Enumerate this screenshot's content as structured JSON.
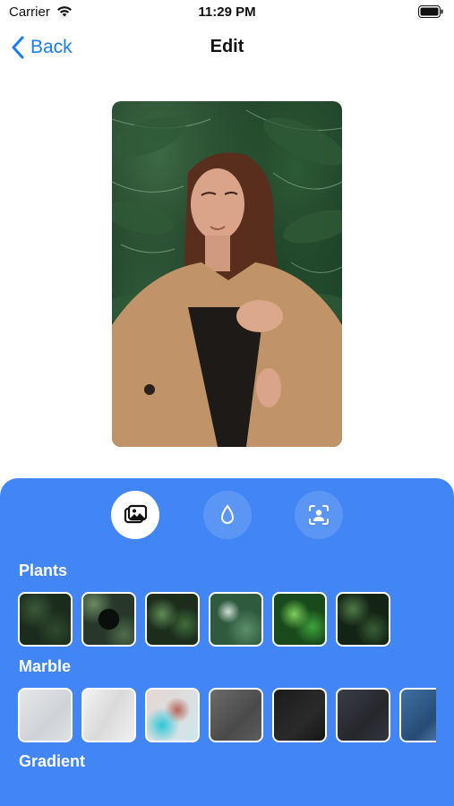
{
  "status_bar": {
    "carrier": "Carrier",
    "time": "11:29 PM"
  },
  "nav": {
    "back_label": "Back",
    "title": "Edit"
  },
  "photo": {
    "description_icon": "portrait-photo"
  },
  "modes": [
    {
      "icon": "photo-stack-icon",
      "active": true
    },
    {
      "icon": "drop-icon",
      "active": false
    },
    {
      "icon": "person-frame-icon",
      "active": false
    }
  ],
  "sections": [
    {
      "title": "Plants",
      "thumbnails": 6
    },
    {
      "title": "Marble",
      "thumbnails": 7
    },
    {
      "title": "Gradient",
      "thumbnails": 0
    }
  ],
  "colors": {
    "accent": "#1a7cf5",
    "panel": "#4285f4"
  }
}
